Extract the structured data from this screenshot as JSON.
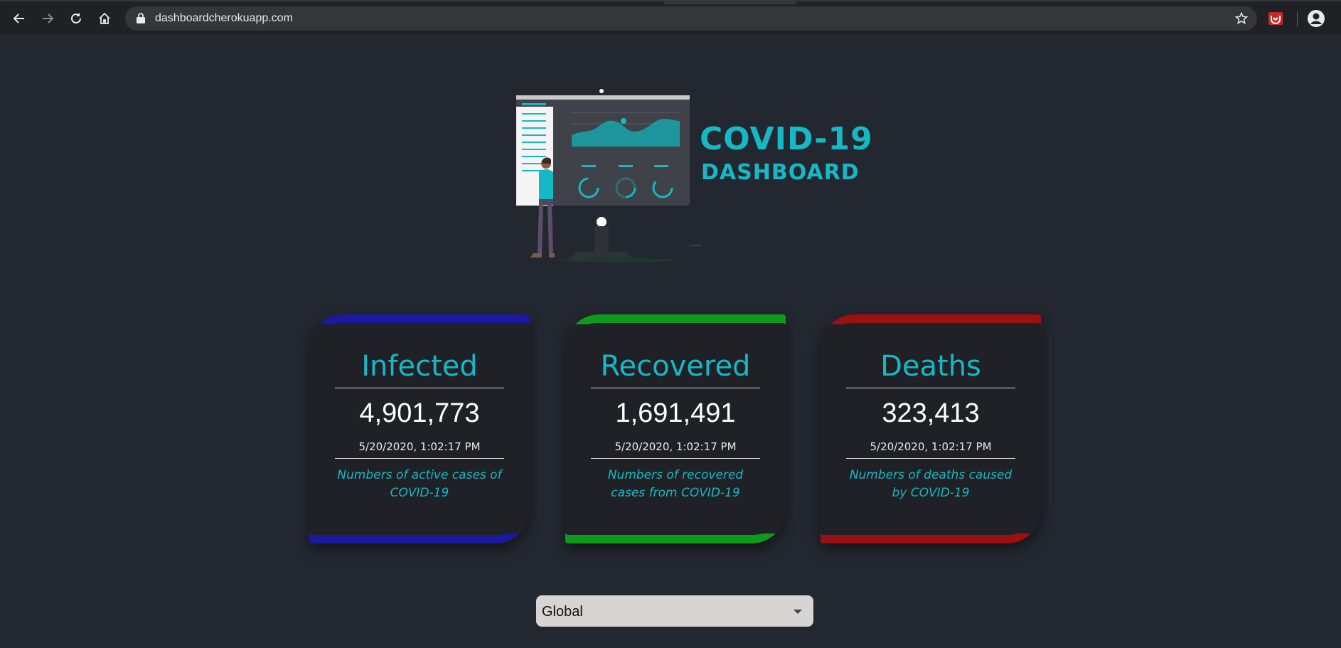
{
  "browser": {
    "url": "dashboardcherokuapp.com",
    "icons": {
      "back": "back-arrow-icon",
      "forward": "forward-arrow-icon",
      "reload": "reload-icon",
      "home": "home-icon",
      "lock": "lock-icon",
      "bookmark": "star-icon",
      "extension": "extension-icon",
      "profile": "profile-icon"
    }
  },
  "hero": {
    "title": "COVID-19",
    "subtitle": "DASHBOARD",
    "accent_color": "#17b8c5"
  },
  "cards": [
    {
      "label": "Infected",
      "count": "4,901,773",
      "timestamp": "5/20/2020, 1:02:17 PM",
      "description": "Numbers of active cases of COVID-19",
      "color": "#1a1a9e"
    },
    {
      "label": "Recovered",
      "count": "1,691,491",
      "timestamp": "5/20/2020, 1:02:17 PM",
      "description": "Numbers of recovered cases from COVID-19",
      "color": "#0e9a1a"
    },
    {
      "label": "Deaths",
      "count": "323,413",
      "timestamp": "5/20/2020, 1:02:17 PM",
      "description": "Numbers of deaths caused by COVID-19",
      "color": "#9b1010"
    }
  ],
  "country_picker": {
    "selected": "Global"
  }
}
